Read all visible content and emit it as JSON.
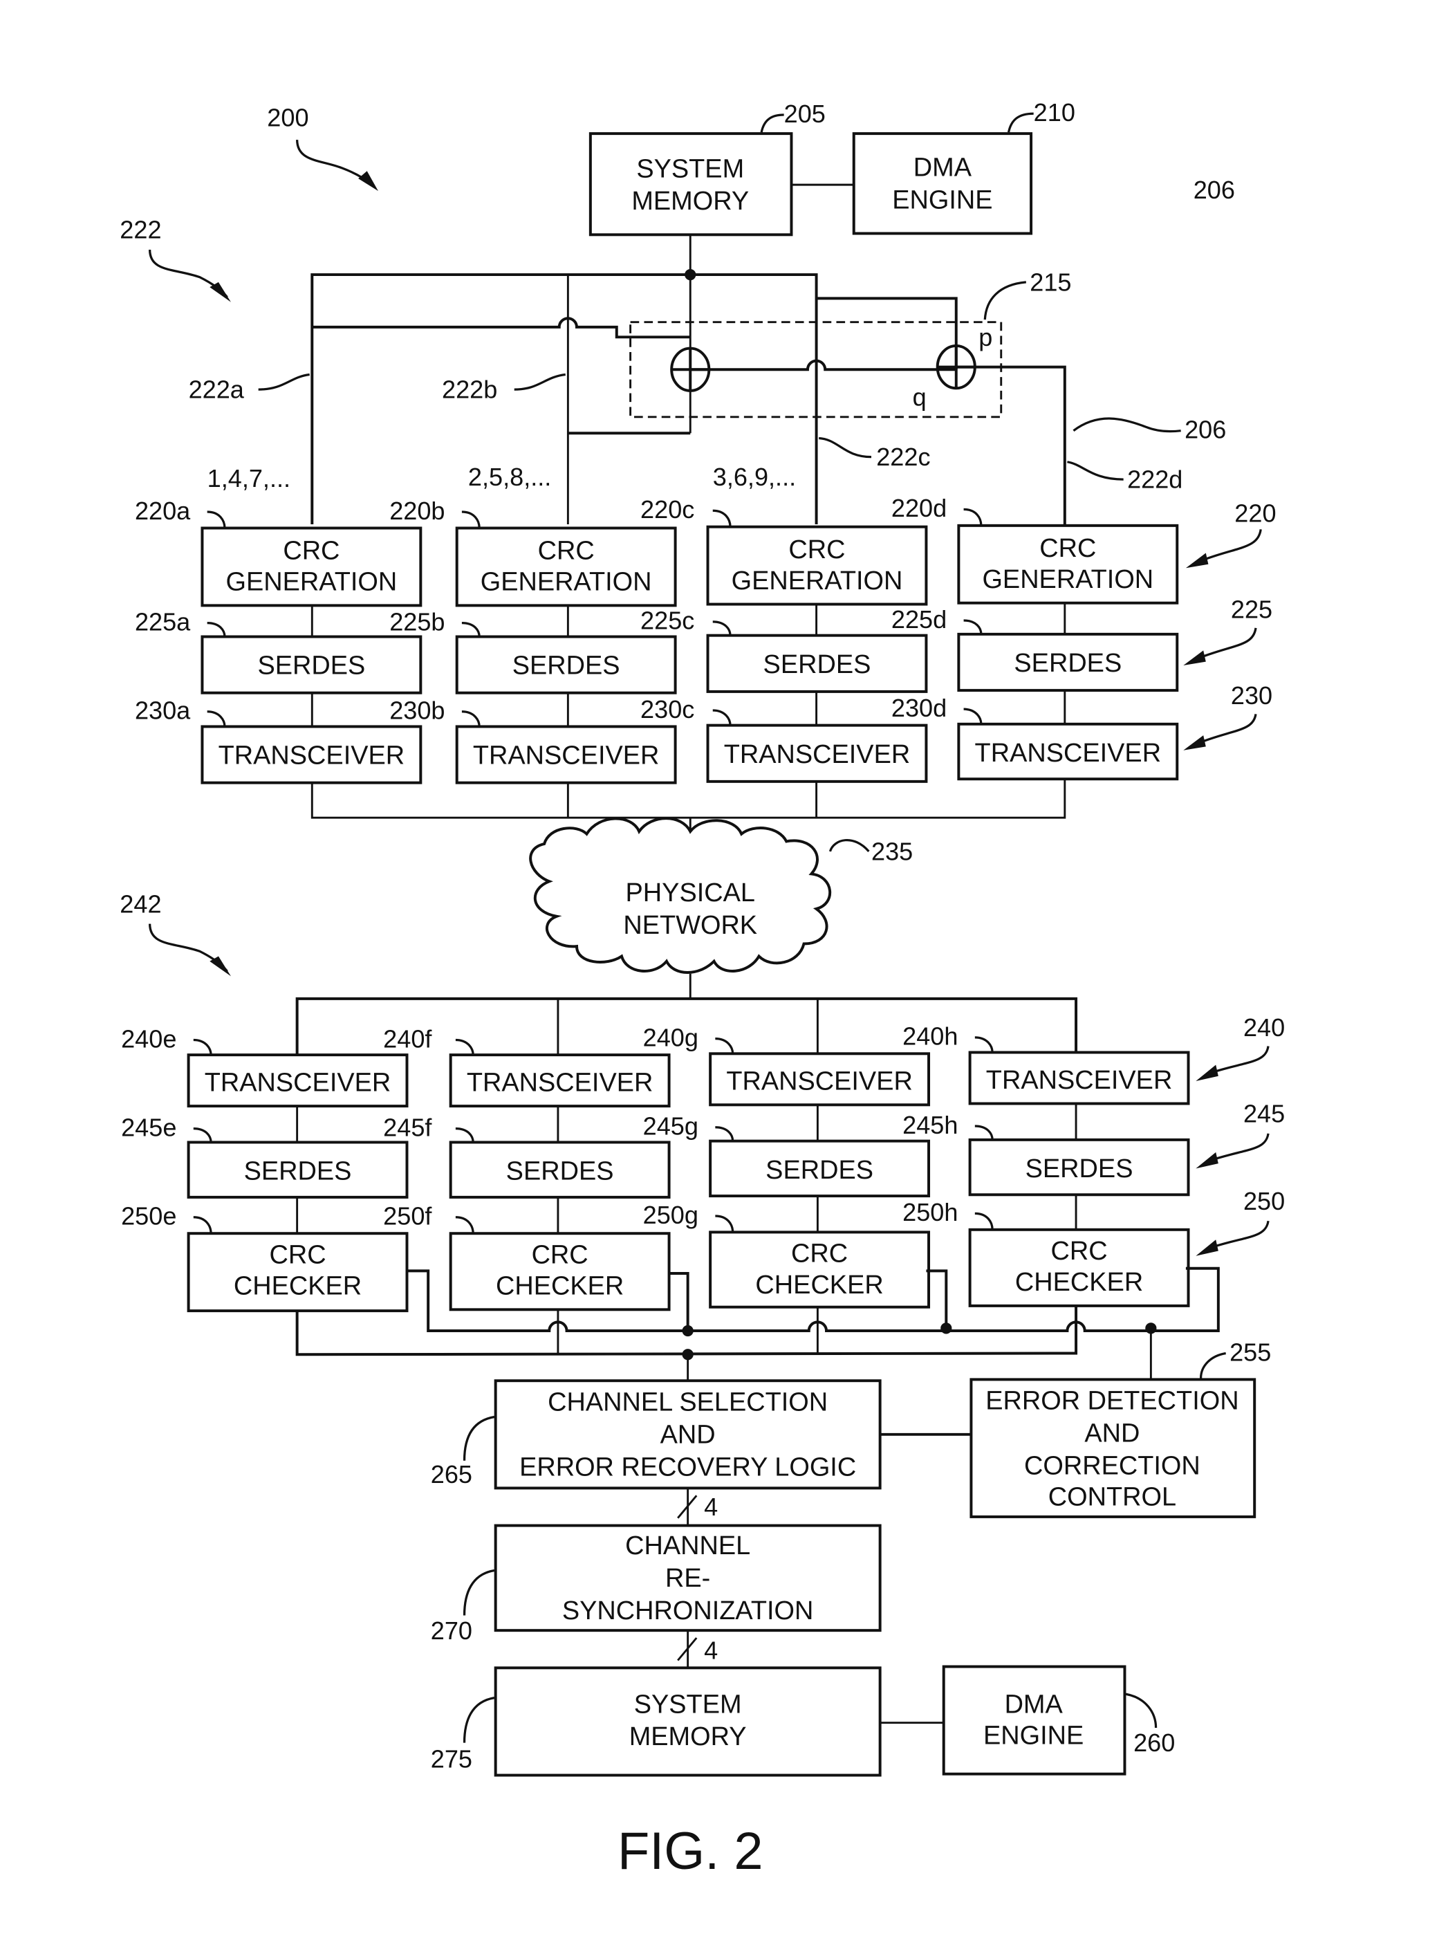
{
  "figure": {
    "caption": "FIG. 2",
    "ref_system": "200",
    "ref_tx_group": "222",
    "ref_rx_group": "242",
    "ref_206_top": "206",
    "ref_206_side": "206"
  },
  "transmit_side": {
    "system_memory": {
      "ref": "205",
      "lines": [
        "SYSTEM",
        "MEMORY"
      ]
    },
    "dma_engine": {
      "ref": "210",
      "lines": [
        "DMA",
        "ENGINE"
      ]
    },
    "xor_block": {
      "ref": "215",
      "p_label": "p",
      "q_label": "q"
    },
    "channel_lines": [
      {
        "ref": "222a",
        "sequence": "1,4,7,..."
      },
      {
        "ref": "222b",
        "sequence": "2,5,8,..."
      },
      {
        "ref": "222c",
        "sequence": "3,6,9,..."
      },
      {
        "ref": "222d",
        "sequence": ""
      }
    ],
    "crc_generation": {
      "group_ref": "220",
      "lines": [
        "CRC",
        "GENERATION"
      ],
      "refs": [
        "220a",
        "220b",
        "220c",
        "220d"
      ]
    },
    "serdes": {
      "group_ref": "225",
      "label": "SERDES",
      "refs": [
        "225a",
        "225b",
        "225c",
        "225d"
      ]
    },
    "transceiver": {
      "group_ref": "230",
      "label": "TRANSCEIVER",
      "refs": [
        "230a",
        "230b",
        "230c",
        "230d"
      ]
    }
  },
  "network": {
    "ref": "235",
    "lines": [
      "PHYSICAL",
      "NETWORK"
    ]
  },
  "receive_side": {
    "transceiver": {
      "group_ref": "240",
      "label": "TRANSCEIVER",
      "refs": [
        "240e",
        "240f",
        "240g",
        "240h"
      ]
    },
    "serdes": {
      "group_ref": "245",
      "label": "SERDES",
      "refs": [
        "245e",
        "245f",
        "245g",
        "245h"
      ]
    },
    "crc_checker": {
      "group_ref": "250",
      "lines": [
        "CRC",
        "CHECKER"
      ],
      "refs": [
        "250e",
        "250f",
        "250g",
        "250h"
      ]
    },
    "error_detection": {
      "ref": "255",
      "lines": [
        "ERROR DETECTION",
        "AND",
        "CORRECTION",
        "CONTROL"
      ]
    },
    "channel_selection": {
      "ref": "265",
      "lines": [
        "CHANNEL SELECTION",
        "AND",
        "ERROR RECOVERY LOGIC"
      ]
    },
    "bus_width_1": "4",
    "channel_resync": {
      "ref": "270",
      "lines": [
        "CHANNEL",
        "RE-",
        "SYNCHRONIZATION"
      ]
    },
    "bus_width_2": "4",
    "system_memory": {
      "ref": "275",
      "lines": [
        "SYSTEM",
        "MEMORY"
      ]
    },
    "dma_engine": {
      "ref": "260",
      "lines": [
        "DMA",
        "ENGINE"
      ]
    }
  }
}
